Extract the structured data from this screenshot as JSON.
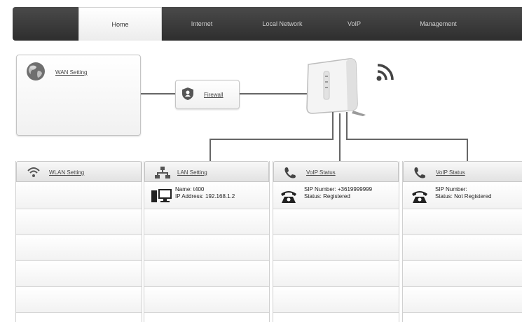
{
  "nav": {
    "tabs": [
      {
        "label": "Home",
        "active": true
      },
      {
        "label": "Internet"
      },
      {
        "label": "Local Network"
      },
      {
        "label": "VoIP"
      },
      {
        "label": "Management"
      }
    ]
  },
  "wan": {
    "label": "WAN Setting",
    "icon": "globe-icon"
  },
  "firewall": {
    "label": "Firewall",
    "icon": "shield-icon"
  },
  "router": {
    "icon": "router-icon",
    "signal_icon": "wifi-signal-icon"
  },
  "columns": {
    "wlan": {
      "label": "WLAN Setting",
      "icon": "wifi-icon"
    },
    "lan": {
      "label": "LAN Setting",
      "icon": "network-icon",
      "device_name": "Name: t400",
      "device_ip": "IP Address: 192.168.1.2",
      "device_icon": "computer-icon"
    },
    "voip1": {
      "label": "VoIP Status",
      "icon": "phone-icon",
      "sip_number": "SIP Number: +3619999999",
      "status": "Status: Registered",
      "device_icon": "telephone-icon"
    },
    "voip2": {
      "label": "VoIP Status",
      "icon": "phone-icon",
      "sip_number": "SIP Number:",
      "status": "Status: Not Registered",
      "device_icon": "telephone-icon"
    }
  }
}
